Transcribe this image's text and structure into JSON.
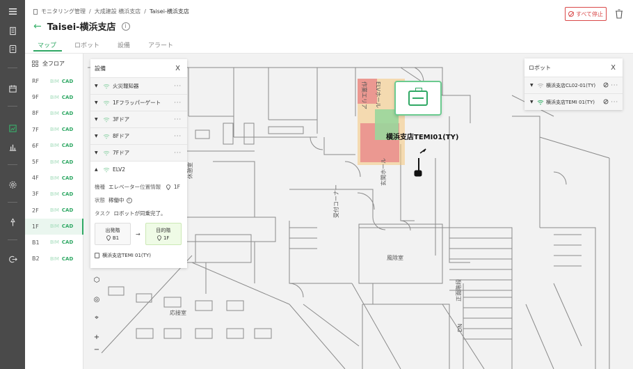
{
  "nav": {
    "icons": [
      "menu-icon",
      "building-icon",
      "document-icon",
      "calendar-icon",
      "chart-line-icon",
      "bar-chart-icon",
      "settings-icon",
      "pin-icon",
      "logout-icon"
    ]
  },
  "breadcrumb": {
    "items": [
      "モニタリング管理",
      "大成建設 横浜支店",
      "Taisei-横浜支店"
    ]
  },
  "header": {
    "title": "Taisei-横浜支店",
    "stop_all_label": "すべて停止"
  },
  "tabs": [
    "マップ",
    "ロボット",
    "設備",
    "アラート"
  ],
  "floors": {
    "header": "全フロア",
    "items": [
      {
        "name": "RF",
        "bim": "BIM",
        "cad": "CAD"
      },
      {
        "name": "9F",
        "bim": "BIM",
        "cad": "CAD"
      },
      {
        "name": "8F",
        "bim": "BIM",
        "cad": "CAD"
      },
      {
        "name": "7F",
        "bim": "BIM",
        "cad": "CAD"
      },
      {
        "name": "6F",
        "bim": "BIM",
        "cad": "CAD"
      },
      {
        "name": "5F",
        "bim": "BIM",
        "cad": "CAD"
      },
      {
        "name": "4F",
        "bim": "BIM",
        "cad": "CAD"
      },
      {
        "name": "3F",
        "bim": "BIM",
        "cad": "CAD"
      },
      {
        "name": "2F",
        "bim": "BIM",
        "cad": "CAD"
      },
      {
        "name": "1F",
        "bim": "BIM",
        "cad": "CAD"
      },
      {
        "name": "B1",
        "bim": "BIM",
        "cad": "CAD"
      },
      {
        "name": "B2",
        "bim": "BIM",
        "cad": "CAD"
      }
    ],
    "active": "1F"
  },
  "equipment_panel": {
    "title": "設備",
    "close": "X",
    "items": [
      "火災報知器",
      "1Fフラッパーゲート",
      "3Fドア",
      "8Fドア",
      "7Fドア",
      "ELV2"
    ],
    "detail": {
      "type_label": "機種",
      "type_value": "エレベーター",
      "location_label": "位置情報",
      "location_value": "1F",
      "status_label": "状態",
      "status_value": "稼働中",
      "task_label": "タスク",
      "task_value": "ロボットが同乗完了。",
      "origin_label": "出発階",
      "origin_value": "B1",
      "dest_label": "目的階",
      "dest_value": "1F",
      "robot_name": "横浜支店TEMI 01(TY)"
    }
  },
  "robot_panel": {
    "title": "ロボット",
    "close": "X",
    "items": [
      "横浜支店CL02-01(TY)",
      "横浜支店TEMI 01(TY)"
    ]
  },
  "map": {
    "robot_label": "横浜支店TEMI01(TY)",
    "labels": [
      "受付コーナー",
      "風除室",
      "正面階段",
      "玄関ホール",
      "休憩室",
      "応接室",
      "DN",
      "ELVホール",
      "作業エリア"
    ]
  },
  "colors": {
    "accent": "#2fa864",
    "danger": "#d94848",
    "zone_red": "#e8878a",
    "zone_orange": "#f6c67a",
    "zone_green": "#9ad69c"
  }
}
